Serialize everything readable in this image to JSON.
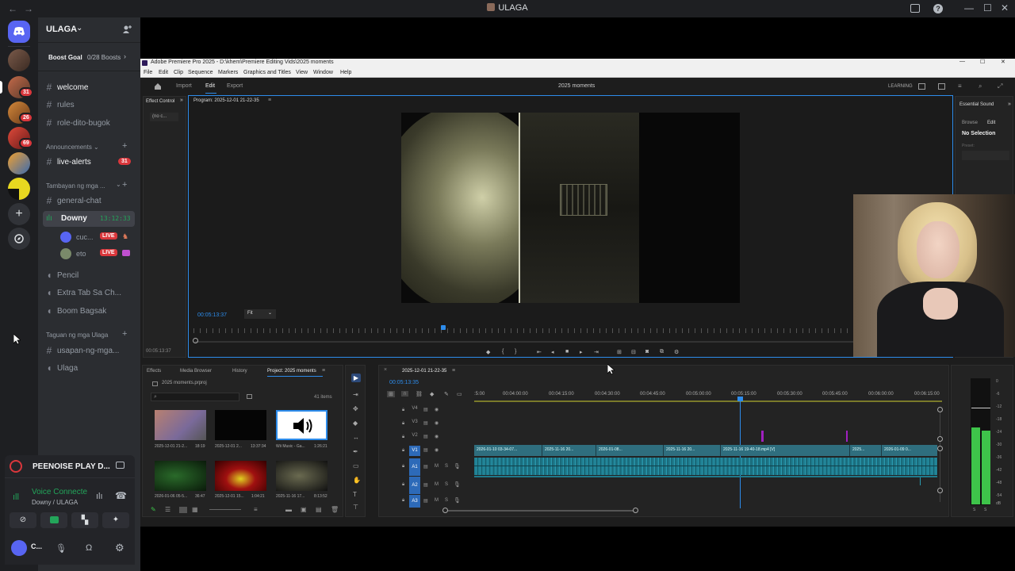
{
  "titlebar": {
    "back": "←",
    "forward": "→",
    "title": "ULAGA",
    "minimize": "—",
    "maximize": "☐",
    "close": "✕"
  },
  "server": {
    "name": "ULAGA",
    "boost_goal": "Boost Goal",
    "boosts": "0/28 Boosts"
  },
  "server_rail": {
    "badges": [
      "31",
      "26",
      "69"
    ]
  },
  "channels": {
    "welcome": "welcome",
    "rules": "rules",
    "role": "role-dito-bugok",
    "announcements": "Announcements",
    "live_alerts": "live-alerts",
    "live_alerts_count": "31",
    "tambayan": "Tambayan ng mga ...",
    "general": "general-chat",
    "downy": "Downy",
    "downy_time": "13:12:33",
    "user1": "cuc...",
    "user2": "eto",
    "live": "LIVE",
    "pencil": "Pencil",
    "extra": "Extra Tab Sa Ch...",
    "boom": "Boom Bagsak",
    "taguan": "Taguan ng mga Ulaga",
    "usapan": "usapan-ng-mga...",
    "ulaga": "Ulaga"
  },
  "voice": {
    "activity": "PEENOISE PLAY D...",
    "connected": "Voice Connecte",
    "location": "Downy / ULAGA",
    "user": "C..."
  },
  "premiere": {
    "app_title": "Adobe Premiere Pro 2025 - D:\\khem\\Premiere Editing Vids\\2025 moments",
    "menu": [
      "File",
      "Edit",
      "Clip",
      "Sequence",
      "Markers",
      "Graphics and Titles",
      "View",
      "Window",
      "Help"
    ],
    "tabs": [
      "Import",
      "Edit",
      "Export"
    ],
    "project_title": "2025 moments",
    "learning": "LEARNING",
    "effect_control": "Effect Control",
    "no_clip": "(no c...",
    "program": "Program: 2025-12-01 21-22-35",
    "timecode": "00:05:13:37",
    "fit": "Fit",
    "left_time": "00:05:13:37",
    "essential_sound": "Essential Sound",
    "browse": "Browse",
    "edit": "Edit",
    "no_selection": "No Selection",
    "preset": "Preset:",
    "bottom_tabs": [
      "Effects",
      "Media Browser",
      "History",
      "Project: 2025 moments"
    ],
    "project_file": "2025 moments.prproj",
    "items": "41 items",
    "thumbs": [
      {
        "name": "2025-12-01 21-2...",
        "dur": "18:19"
      },
      {
        "name": "2025-12-01 2...",
        "dur": "13:37:34"
      },
      {
        "name": "Wii Music - Ga...",
        "dur": "1:26:21"
      },
      {
        "name": "2026-01-06 05-5...",
        "dur": "36:47"
      },
      {
        "name": "2025-12-01 15...",
        "dur": "1:04:21"
      },
      {
        "name": "2025-11-16 17...",
        "dur": "8:13:52"
      }
    ],
    "sequence": "2025-12-01 21-22-35",
    "seq_time": "00:05:13:35",
    "ruler": [
      ":5:00",
      "00:04:00:00",
      "00:04:15:00",
      "00:04:30:00",
      "00:04:45:00",
      "00:05:00:00",
      "00:05:15:00",
      "00:05:30:00",
      "00:05:45:00",
      "00:06:00:00",
      "00:06:15:00"
    ],
    "tracks": [
      "V4",
      "V3",
      "V2",
      "V1",
      "A1",
      "A2",
      "A3"
    ],
    "clips": [
      "2026-01-10 03-34-07...",
      "2025-11-16 20...",
      "2026-01-08...",
      "2025-11-16 20...",
      "2025-11-16 19-40-18.mp4 [V]",
      "2025...",
      "2026-01-09 0..."
    ],
    "meter_db": [
      "0",
      "-6",
      "-12",
      "-18",
      "-24",
      "-30",
      "-36",
      "-42",
      "-48",
      "-54",
      "dB"
    ],
    "meter_s": "S"
  },
  "colors": {
    "discord_bg": "#2b2d31",
    "rail_bg": "#1e1f22",
    "live_red": "#da373c",
    "pr_blue": "#2d8ceb",
    "clip_teal": "#2f6e7e",
    "audio_teal": "#1e7a8c",
    "green_meter": "#3ec44a"
  }
}
